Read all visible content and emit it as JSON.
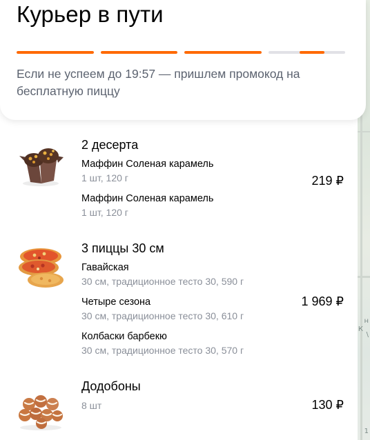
{
  "status": {
    "title": "Курьер в пути",
    "subtitle": "Если не успеем до 19:57 — пришлем промокод на бесплатную пиццу",
    "accent_color": "#ff6900",
    "progress_segments": [
      1.0,
      1.0,
      1.0,
      0.32
    ]
  },
  "groups": [
    {
      "title": "2 десерта",
      "icon": "muffin-icon",
      "price": "219 ₽",
      "items": [
        {
          "name": "Маффин Соленая карамель",
          "meta": "1 шт, 120 г"
        },
        {
          "name": "Маффин Соленая карамель",
          "meta": "1 шт, 120 г"
        }
      ]
    },
    {
      "title": "3 пиццы 30 см",
      "icon": "pizza-icon",
      "price": "1 969 ₽",
      "items": [
        {
          "name": "Гавайская",
          "meta": "30 см, традиционное тесто 30, 590 г"
        },
        {
          "name": "Четыре сезона",
          "meta": "30 см, традиционное тесто 30, 610 г"
        },
        {
          "name": "Колбаски барбекю",
          "meta": "30 см, традиционное тесто 30, 570 г"
        }
      ]
    },
    {
      "title": "Додобоны",
      "icon": "buns-icon",
      "price": "130 ₽",
      "items": [
        {
          "meta": "8 шт"
        }
      ]
    }
  ],
  "map": {
    "labels": [
      "н",
      "\\",
      "К",
      "1"
    ]
  }
}
